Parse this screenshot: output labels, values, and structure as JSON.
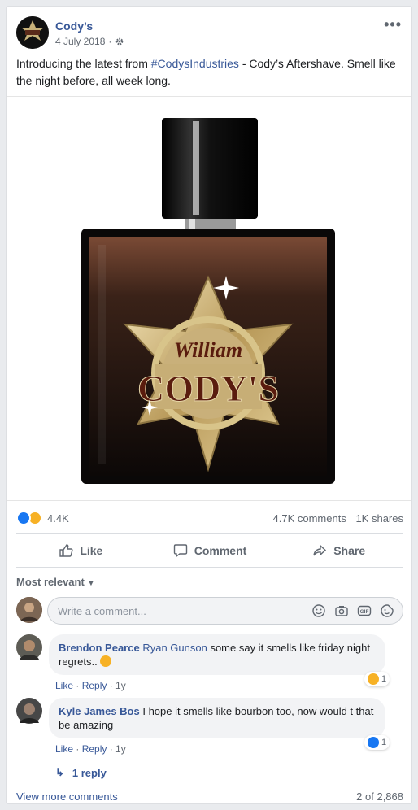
{
  "post": {
    "page_name": "Cody’s",
    "date": "4 July 2018",
    "text_before": "Introducing the latest from ",
    "hashtag": "#CodysIndustries",
    "text_after": " - Cody’s Aftershave. Smell like the night before, all week long.",
    "image": {
      "logo_top": "William",
      "logo_main": "CODY'S"
    },
    "reactions_count": "4.4K",
    "comments_count": "4.7K comments",
    "shares_count": "1K shares"
  },
  "actions": {
    "like": "Like",
    "comment": "Comment",
    "share": "Share"
  },
  "sort_label": "Most relevant",
  "composer": {
    "placeholder": "Write a comment..."
  },
  "comments": [
    {
      "author": "Brendon Pearce",
      "mention": "Ryan Gunson",
      "text": " some say it smells like friday night regrets.. ",
      "like": "Like",
      "reply": "Reply",
      "age": "1y",
      "reaction_count": "1"
    },
    {
      "author": "Kyle James Bos",
      "text": " I hope it smells like bourbon too, now would t that be amazing",
      "like": "Like",
      "reply": "Reply",
      "age": "1y",
      "reaction_count": "1"
    }
  ],
  "replies": "1 reply",
  "footer": {
    "view_more": "View more comments",
    "pagination": "2 of 2,868"
  },
  "colors": {
    "link": "#385898",
    "like_blue": "#1877f2",
    "haha": "#f7b125"
  }
}
